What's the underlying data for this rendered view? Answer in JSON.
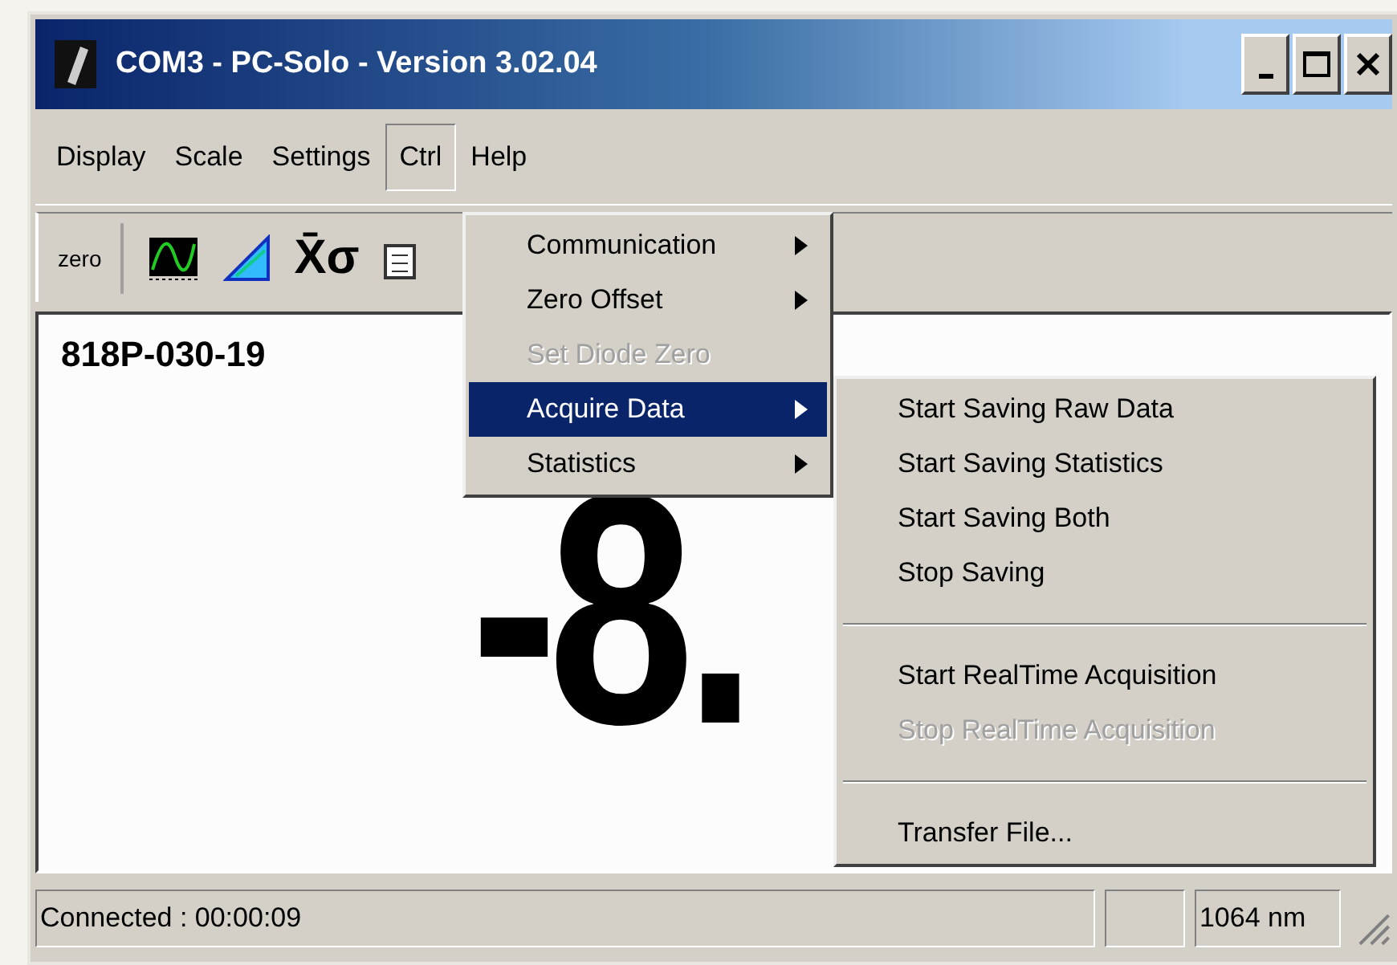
{
  "window": {
    "title": "COM3 - PC-Solo - Version 3.02.04"
  },
  "menu_bar": [
    {
      "label": "Display",
      "selected": false
    },
    {
      "label": "Scale",
      "selected": false
    },
    {
      "label": "Settings",
      "selected": false
    },
    {
      "label": "Ctrl",
      "selected": true
    },
    {
      "label": "Help",
      "selected": false
    }
  ],
  "toolbar": {
    "zero_button": "zero",
    "stats_button": "X̄σ"
  },
  "display": {
    "sensor": "818P-030-19",
    "reading": "-8."
  },
  "ctrl_menu": [
    {
      "label": "Communication",
      "submenu": true,
      "disabled": false,
      "selected": false
    },
    {
      "label": "Zero Offset",
      "submenu": true,
      "disabled": false,
      "selected": false
    },
    {
      "label": "Set Diode Zero",
      "submenu": false,
      "disabled": true,
      "selected": false
    },
    {
      "label": "Acquire Data",
      "submenu": true,
      "disabled": false,
      "selected": true
    },
    {
      "label": "Statistics",
      "submenu": true,
      "disabled": false,
      "selected": false
    }
  ],
  "acquire_menu": [
    {
      "kind": "item",
      "label": "Start Saving Raw Data",
      "disabled": false
    },
    {
      "kind": "item",
      "label": "Start Saving Statistics",
      "disabled": false
    },
    {
      "kind": "item",
      "label": "Start Saving Both",
      "disabled": false
    },
    {
      "kind": "item",
      "label": "Stop Saving",
      "disabled": false
    },
    {
      "kind": "separator"
    },
    {
      "kind": "item",
      "label": "Start RealTime Acquisition",
      "disabled": false
    },
    {
      "kind": "item",
      "label": "Stop RealTime Acquisition",
      "disabled": true
    },
    {
      "kind": "separator"
    },
    {
      "kind": "item",
      "label": "Transfer File...",
      "disabled": false
    }
  ],
  "status_bar": {
    "connection": "Connected : 00:00:09",
    "wavelength": "1064 nm"
  }
}
